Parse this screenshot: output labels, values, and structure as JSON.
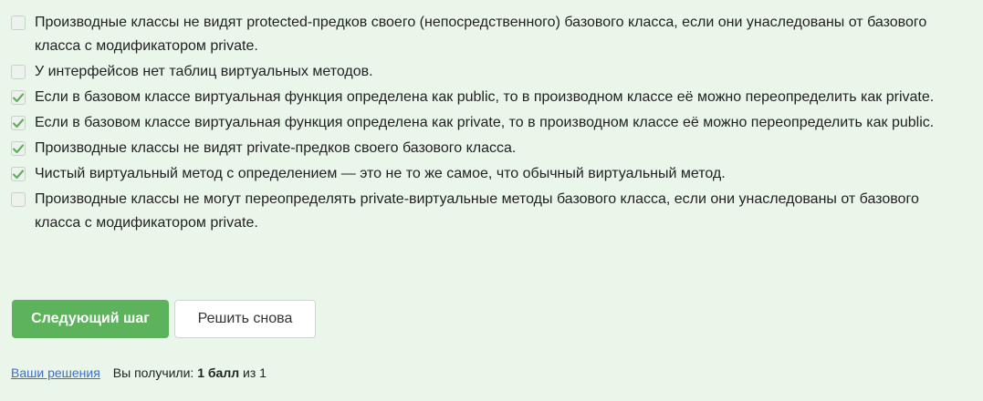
{
  "options": [
    {
      "text": "Производные классы не видят protected-предков своего (непосредственного) базового класса, если они унаследованы от базового класса с модификатором private.",
      "checked": false
    },
    {
      "text": "У интерфейсов нет таблиц виртуальных методов.",
      "checked": false
    },
    {
      "text": "Если в базовом классе виртуальная функция определена как public, то в производном классе её можно переопределить как private.",
      "checked": true
    },
    {
      "text": "Если в базовом классе виртуальная функция определена как private, то в производном классе её можно переопределить как public.",
      "checked": true
    },
    {
      "text": "Производные классы не видят private-предков своего базового класса.",
      "checked": true
    },
    {
      "text": "Чистый виртуальный метод с определением — это не то же самое, что обычный виртуальный метод.",
      "checked": true
    },
    {
      "text": "Производные классы не могут переопределять private-виртуальные методы базового класса, если они унаследованы от базового класса с модификатором private.",
      "checked": false
    }
  ],
  "buttons": {
    "next_step": "Следующий шаг",
    "retry": "Решить снова"
  },
  "footer": {
    "solutions_link": "Ваши решения",
    "score_prefix": "Вы получили:",
    "score_value": "1 балл",
    "score_suffix": "из 1"
  },
  "colors": {
    "background": "#e9f6e9",
    "primary_button": "#5cb35c",
    "checkmark": "#5cb35c",
    "link": "#3c6fcc"
  },
  "icons": {
    "checkmark": "check-icon"
  }
}
